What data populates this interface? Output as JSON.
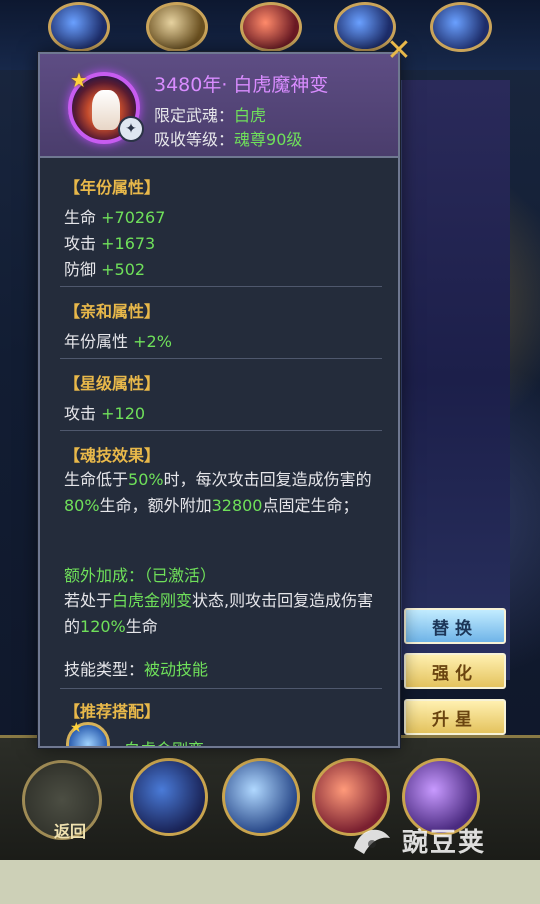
{
  "ring": {
    "title": "3480年· 白虎魔神变",
    "limited_label": "限定武魂：",
    "limited_value": "白虎",
    "absorb_label": "吸收等级：",
    "absorb_value": "魂尊90级"
  },
  "year_attr": {
    "heading": "【年份属性】",
    "stats": [
      {
        "label": "生命",
        "value": "+70267"
      },
      {
        "label": "攻击",
        "value": "+1673"
      },
      {
        "label": "防御",
        "value": "+502"
      }
    ]
  },
  "affinity": {
    "heading": "【亲和属性】",
    "label": "年份属性",
    "value": "+2%"
  },
  "star_attr": {
    "heading": "【星级属性】",
    "label": "攻击",
    "value": "+120"
  },
  "skill_effect": {
    "heading": "【魂技效果】",
    "d1": "生命低于",
    "d2": "50%",
    "d3": "时，每次攻击回复造成伤害的",
    "d4": "80%",
    "d5": "生命，额外附加",
    "d6": "32800",
    "d7": "点固定生命；",
    "bonus_line": "额外加成：（已激活）",
    "e1": "若处于",
    "e2": "白虎金刚变",
    "e3": "状态,则攻击回复造成伤害的",
    "e4": "120%",
    "e5": "生命",
    "type_label": "技能类型：",
    "type_value": "被动技能"
  },
  "recommend": {
    "heading": "【推荐搭配】",
    "item_name": "白虎金刚变"
  },
  "buttons": {
    "replace": "替换",
    "enhance": "强化",
    "star_up": "升星",
    "back": "返回"
  },
  "watermark": "豌豆荚",
  "colors": {
    "title_purple": "#d98cff",
    "value_green": "#6fe05a",
    "heading_gold": "#e8b84a"
  }
}
